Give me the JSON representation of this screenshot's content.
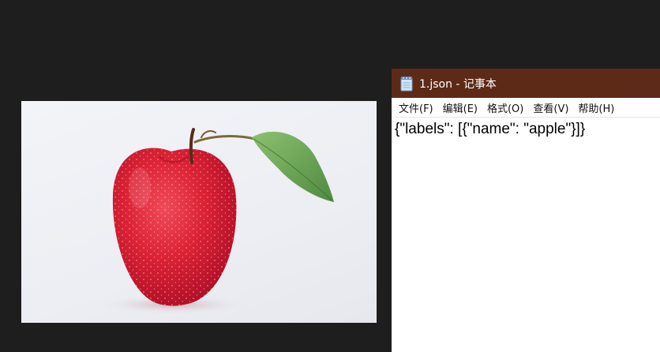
{
  "image_viewer": {
    "image_subject": "apple",
    "colors": {
      "background": "#1e1e1e",
      "photo_bg": "#eceef3",
      "apple_red": "#d8253c",
      "leaf_green": "#6fa35a"
    }
  },
  "notepad": {
    "title": "1.json - 记事本",
    "icon": "notepad-icon",
    "titlebar_color": "#5e2a18",
    "menu": [
      {
        "label": "文件(F)"
      },
      {
        "label": "编辑(E)"
      },
      {
        "label": "格式(O)"
      },
      {
        "label": "查看(V)"
      },
      {
        "label": "帮助(H)"
      }
    ],
    "content": "{\"labels\": [{\"name\": \"apple\"}]}"
  }
}
